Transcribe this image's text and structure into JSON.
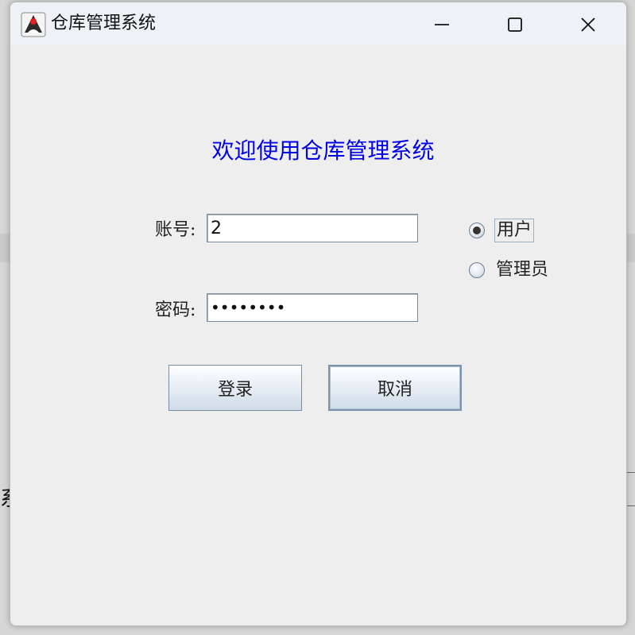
{
  "window": {
    "title": "仓库管理系统",
    "controls": {
      "minimize_icon": "minimize-icon",
      "maximize_icon": "maximize-icon",
      "close_icon": "close-icon"
    }
  },
  "form": {
    "welcome": "欢迎使用仓库管理系统",
    "account_label": "账号:",
    "account_value": "2",
    "password_label": "密码:",
    "password_value": "••••••••",
    "role_options": [
      {
        "label": "用户",
        "selected": true
      },
      {
        "label": "管理员",
        "selected": false
      }
    ],
    "login_button": "登录",
    "cancel_button": "取消"
  },
  "background": {
    "partial_text": "系"
  },
  "colors": {
    "welcome_text": "#0000e6",
    "titlebar": "#eef2f7",
    "window_bg": "#eeeeee"
  }
}
